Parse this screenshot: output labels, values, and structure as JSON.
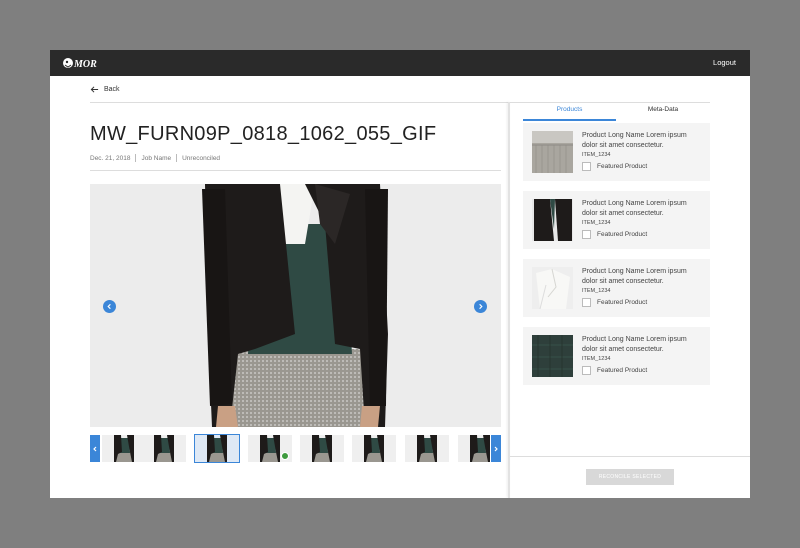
{
  "header": {
    "logo_text": "MOR",
    "logout_label": "Logout"
  },
  "nav": {
    "back_label": "Back"
  },
  "asset": {
    "title": "MW_FURN09P_0818_1062_055_GIF",
    "date": "Dec. 21, 2018",
    "job": "Job Name",
    "status": "Unreconciled"
  },
  "thumbnails": [
    {
      "selected": false,
      "badge": false
    },
    {
      "selected": false,
      "badge": false
    },
    {
      "selected": true,
      "badge": false
    },
    {
      "selected": false,
      "badge": true
    },
    {
      "selected": false,
      "badge": false
    },
    {
      "selected": false,
      "badge": false
    },
    {
      "selected": false,
      "badge": false
    },
    {
      "selected": false,
      "badge": false
    }
  ],
  "tabs": [
    {
      "label": "Products",
      "active": true
    },
    {
      "label": "Meta-Data",
      "active": false
    }
  ],
  "products": [
    {
      "name": "Product Long Name Lorem ipsum dolor sit amet consectetur.",
      "item": "ITEM_1234",
      "featured_label": "Featured Product",
      "swatch": "skirt"
    },
    {
      "name": "Product Long Name Lorem ipsum dolor sit amet consectetur.",
      "item": "ITEM_1234",
      "featured_label": "Featured Product",
      "swatch": "jacket"
    },
    {
      "name": "Product Long Name Lorem ipsum dolor sit amet consectetur.",
      "item": "ITEM_1234",
      "featured_label": "Featured Product",
      "swatch": "blouse"
    },
    {
      "name": "Product Long Name Lorem ipsum dolor sit amet consectetur.",
      "item": "ITEM_1234",
      "featured_label": "Featured Product",
      "swatch": "knit"
    }
  ],
  "actions": {
    "reconcile_label": "RECONCILE SELECTED"
  },
  "colors": {
    "accent": "#3b86d8",
    "topbar": "#2a2a2a",
    "badge": "#3d9a3d"
  }
}
